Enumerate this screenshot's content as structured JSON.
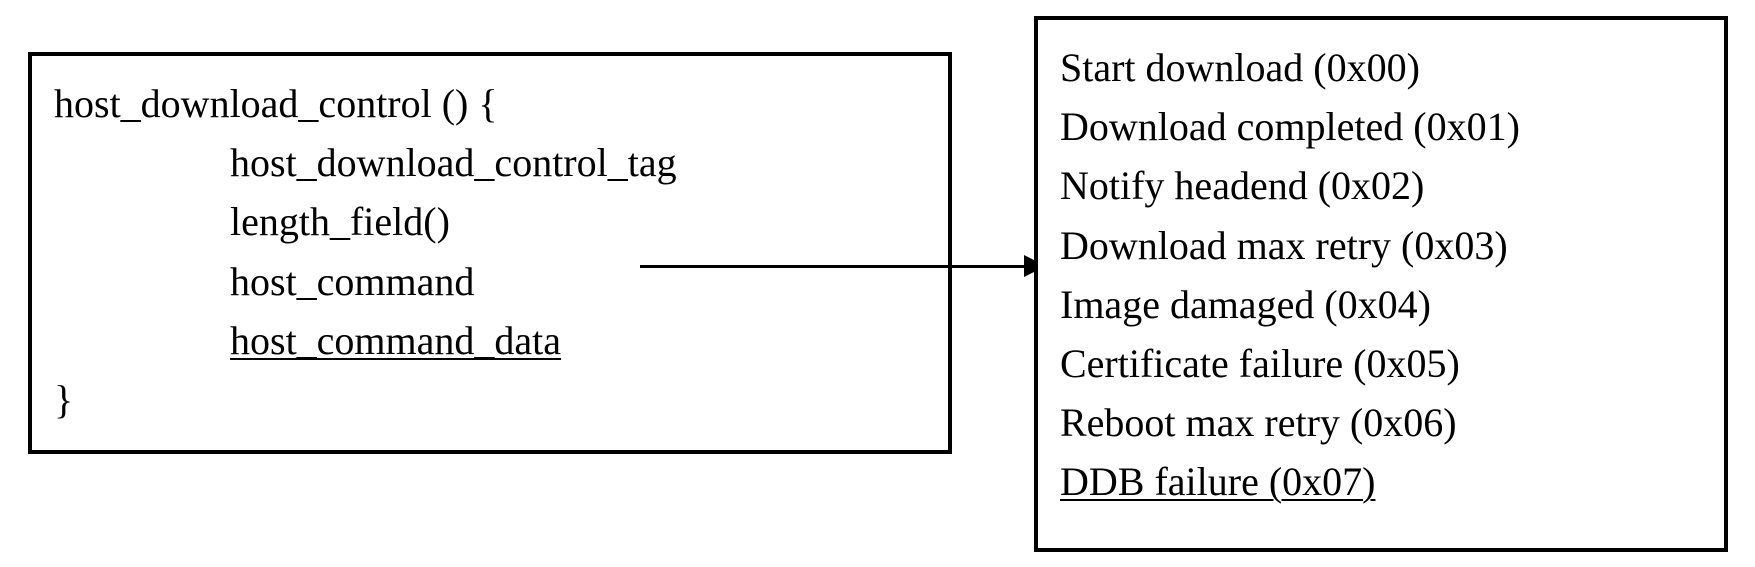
{
  "left": {
    "fn_open": "host_download_control () {",
    "line1": "host_download_control_tag",
    "line2": "length_field()",
    "line3": "host_command",
    "line4": "host_command_data",
    "fn_close": "}"
  },
  "right": {
    "items": [
      "Start download (0x00)",
      "Download completed (0x01)",
      "Notify headend (0x02)",
      "Download max retry (0x03)",
      "Image damaged (0x04)",
      "Certificate failure (0x05)",
      "Reboot max retry (0x06)",
      "DDB failure (0x07)"
    ]
  }
}
